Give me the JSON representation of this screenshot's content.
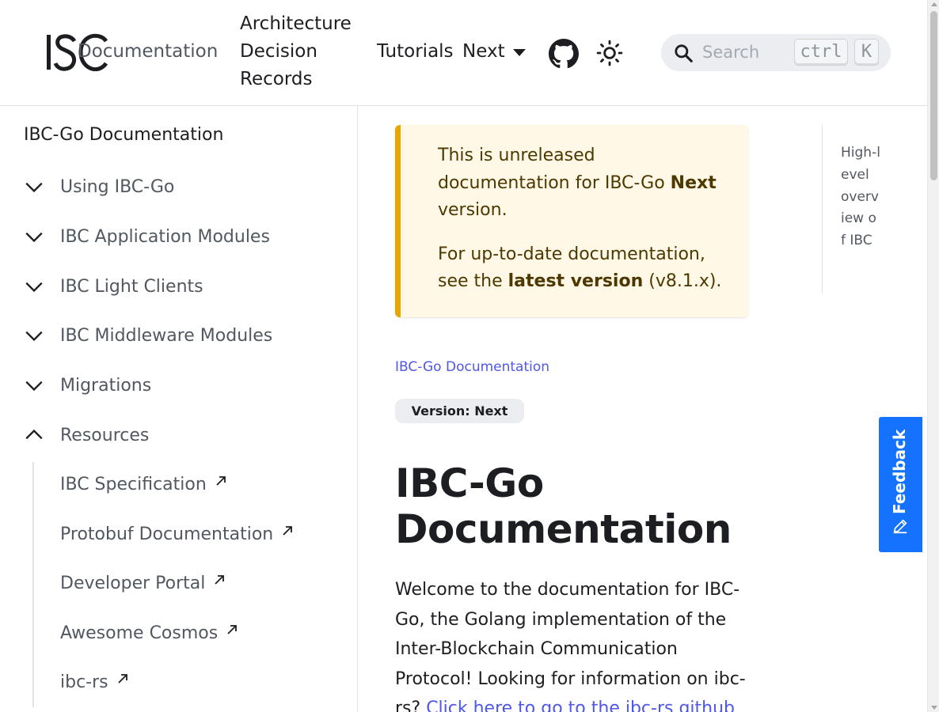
{
  "navbar": {
    "logo_text": "IBC",
    "links": {
      "documentation": "Documentation",
      "adr": "Architecture Decision Records",
      "tutorials": "Tutorials",
      "next": "Next"
    },
    "search": {
      "placeholder": "Search",
      "kbd_ctrl": "ctrl",
      "kbd_k": "K"
    }
  },
  "sidebar": {
    "title": "IBC-Go Documentation",
    "items": [
      {
        "label": "Using IBC-Go",
        "state": "collapsed"
      },
      {
        "label": "IBC Application Modules",
        "state": "collapsed"
      },
      {
        "label": "IBC Light Clients",
        "state": "collapsed"
      },
      {
        "label": "IBC Middleware Modules",
        "state": "collapsed"
      },
      {
        "label": "Migrations",
        "state": "collapsed"
      },
      {
        "label": "Resources",
        "state": "expanded"
      }
    ],
    "sub_items": [
      {
        "label": "IBC Specification"
      },
      {
        "label": "Protobuf Documentation"
      },
      {
        "label": "Developer Portal"
      },
      {
        "label": "Awesome Cosmos"
      },
      {
        "label": "ibc-rs"
      }
    ]
  },
  "main": {
    "admonition": {
      "line1_pre": "This is unreleased documentation for IBC-Go ",
      "line1_bold": "Next",
      "line1_post": " version.",
      "line2_pre": "For up-to-date documentation, see the ",
      "line2_bold": "latest version",
      "line2_post": " (v8.1.x)."
    },
    "breadcrumb": "IBC-Go Documentation",
    "version_badge": "Version: Next",
    "title": "IBC-Go Documentation",
    "intro_text": "Welcome to the documentation for IBC-Go, the Golang implementation of the Inter-Blockchain Communication Protocol! Looking for information on ibc-rs? ",
    "intro_link": "Click here to go to the ibc-rs github"
  },
  "toc": {
    "link": "High-level overview of IBC"
  },
  "feedback": {
    "label": "Feedback"
  },
  "colors": {
    "accent": "#4f57e8",
    "admonition_bg": "#fff8e6",
    "admonition_border": "#e6a700",
    "feedback_bg": "#1472ff"
  }
}
